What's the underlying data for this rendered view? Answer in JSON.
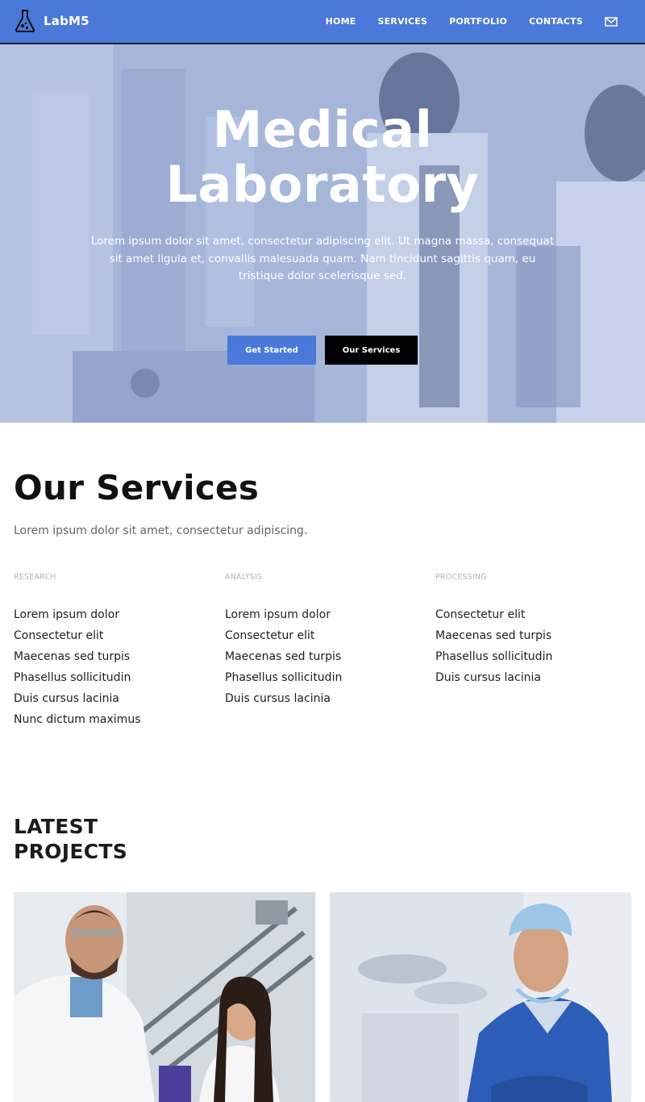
{
  "brand": {
    "name": "LabM5",
    "icon": "flask-icon"
  },
  "nav": {
    "items": [
      {
        "label": "HOME"
      },
      {
        "label": "SERVICES"
      },
      {
        "label": "PORTFOLIO"
      },
      {
        "label": "CONTACTS"
      }
    ],
    "icon": "mail-icon"
  },
  "hero": {
    "title_line1": "Medical",
    "title_line2": "Laboratory",
    "text": "Lorem ipsum dolor sit amet, consectetur adipiscing elit. Ut magna massa, consequat sit amet ligula et, convallis malesuada quam. Nam tincidunt sagittis quam, eu tristique dolor scelerisque sed.",
    "primary_button": "Get Started",
    "secondary_button": "Our Services"
  },
  "services": {
    "title": "Our Services",
    "subtitle": "Lorem ipsum dolor sit amet, consectetur adipiscing.",
    "columns": [
      {
        "heading": "RESEARCH",
        "items": [
          "Lorem ipsum dolor",
          "Consectetur elit",
          "Maecenas sed turpis",
          "Phasellus sollicitudin",
          "Duis cursus lacinia",
          "Nunc dictum maximus"
        ]
      },
      {
        "heading": "ANALYSIS",
        "items": [
          "Lorem ipsum dolor",
          "Consectetur elit",
          "Maecenas sed turpis",
          "Phasellus sollicitudin",
          "Duis cursus lacinia"
        ]
      },
      {
        "heading": "PROCESSING",
        "items": [
          "Consectetur elit",
          "Maecenas sed turpis",
          "Phasellus sollicitudin",
          "Duis cursus lacinia"
        ]
      }
    ]
  },
  "projects": {
    "title_line1": "LATEST",
    "title_line2": "PROJECTS"
  },
  "colors": {
    "accent": "#4a79d9",
    "dark_button": "#000000"
  }
}
